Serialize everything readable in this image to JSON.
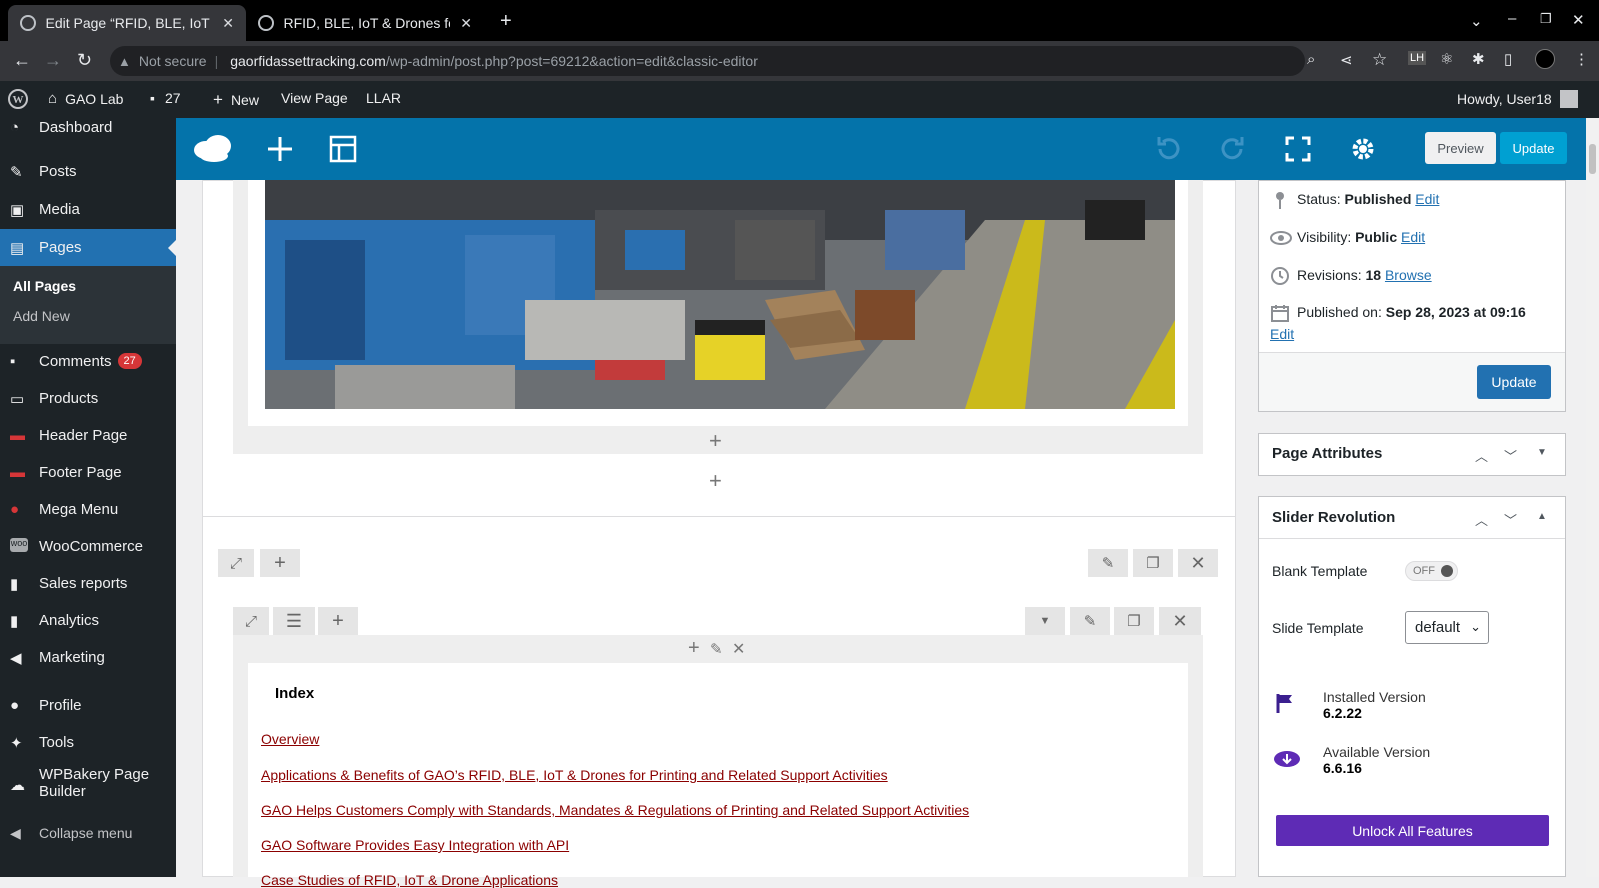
{
  "browser": {
    "tabs": [
      {
        "title": "Edit Page “RFID, BLE, IoT &",
        "active": true
      },
      {
        "title": "RFID, BLE, IoT & Drones fo",
        "active": false
      }
    ],
    "security_label": "Not secure",
    "url_host": "gaorfidassettracking.com",
    "url_path": "/wp-admin/post.php?post=69212&action=edit&classic-editor"
  },
  "admin_bar": {
    "site_name": "GAO Lab",
    "comments_count": "27",
    "new_label": "New",
    "view_page": "View Page",
    "llar": "LLAR",
    "howdy": "Howdy, User18"
  },
  "sidebar": {
    "dashboard": "Dashboard",
    "posts": "Posts",
    "media": "Media",
    "pages": "Pages",
    "all_pages": "All Pages",
    "add_new": "Add New",
    "comments": "Comments",
    "comments_badge": "27",
    "products": "Products",
    "header_page": "Header Page",
    "footer_page": "Footer Page",
    "mega_menu": "Mega Menu",
    "woocommerce": "WooCommerce",
    "sales_reports": "Sales reports",
    "analytics": "Analytics",
    "marketing": "Marketing",
    "profile": "Profile",
    "tools": "Tools",
    "wpbakery_line1": "WPBakery Page",
    "wpbakery_line2": "Builder",
    "collapse": "Collapse menu"
  },
  "builder_toolbar": {
    "preview": "Preview",
    "update": "Update"
  },
  "index": {
    "title": "Index",
    "links": [
      "Overview",
      "Applications & Benefits of GAO’s RFID, BLE, IoT & Drones for Printing and Related Support Activities",
      "GAO Helps Customers Comply with Standards, Mandates & Regulations of Printing and Related Support Activities",
      "GAO Software Provides Easy Integration with API",
      "Case Studies of RFID, IoT & Drone Applications"
    ]
  },
  "publish": {
    "status_label": "Status:",
    "status_value": "Published",
    "visibility_label": "Visibility:",
    "visibility_value": "Public",
    "revisions_label": "Revisions:",
    "revisions_value": "18",
    "browse": "Browse",
    "published_on_label": "Published on:",
    "published_on_value": "Sep 28, 2023 at 09:16",
    "edit": "Edit",
    "update": "Update"
  },
  "page_attributes": {
    "title": "Page Attributes"
  },
  "slider_revolution": {
    "title": "Slider Revolution",
    "blank_template_label": "Blank Template",
    "blank_template_value": "OFF",
    "slide_template_label": "Slide Template",
    "slide_template_value": "default",
    "installed_label": "Installed Version",
    "installed_value": "6.2.22",
    "available_label": "Available Version",
    "available_value": "6.6.16",
    "unlock": "Unlock All Features"
  },
  "colors": {
    "wp_dark": "#1d2327",
    "wp_blue": "#2271b1",
    "wpbakery_bar": "#0473aa",
    "slider_purple": "#5e2bb5",
    "index_link": "#8b0000"
  }
}
